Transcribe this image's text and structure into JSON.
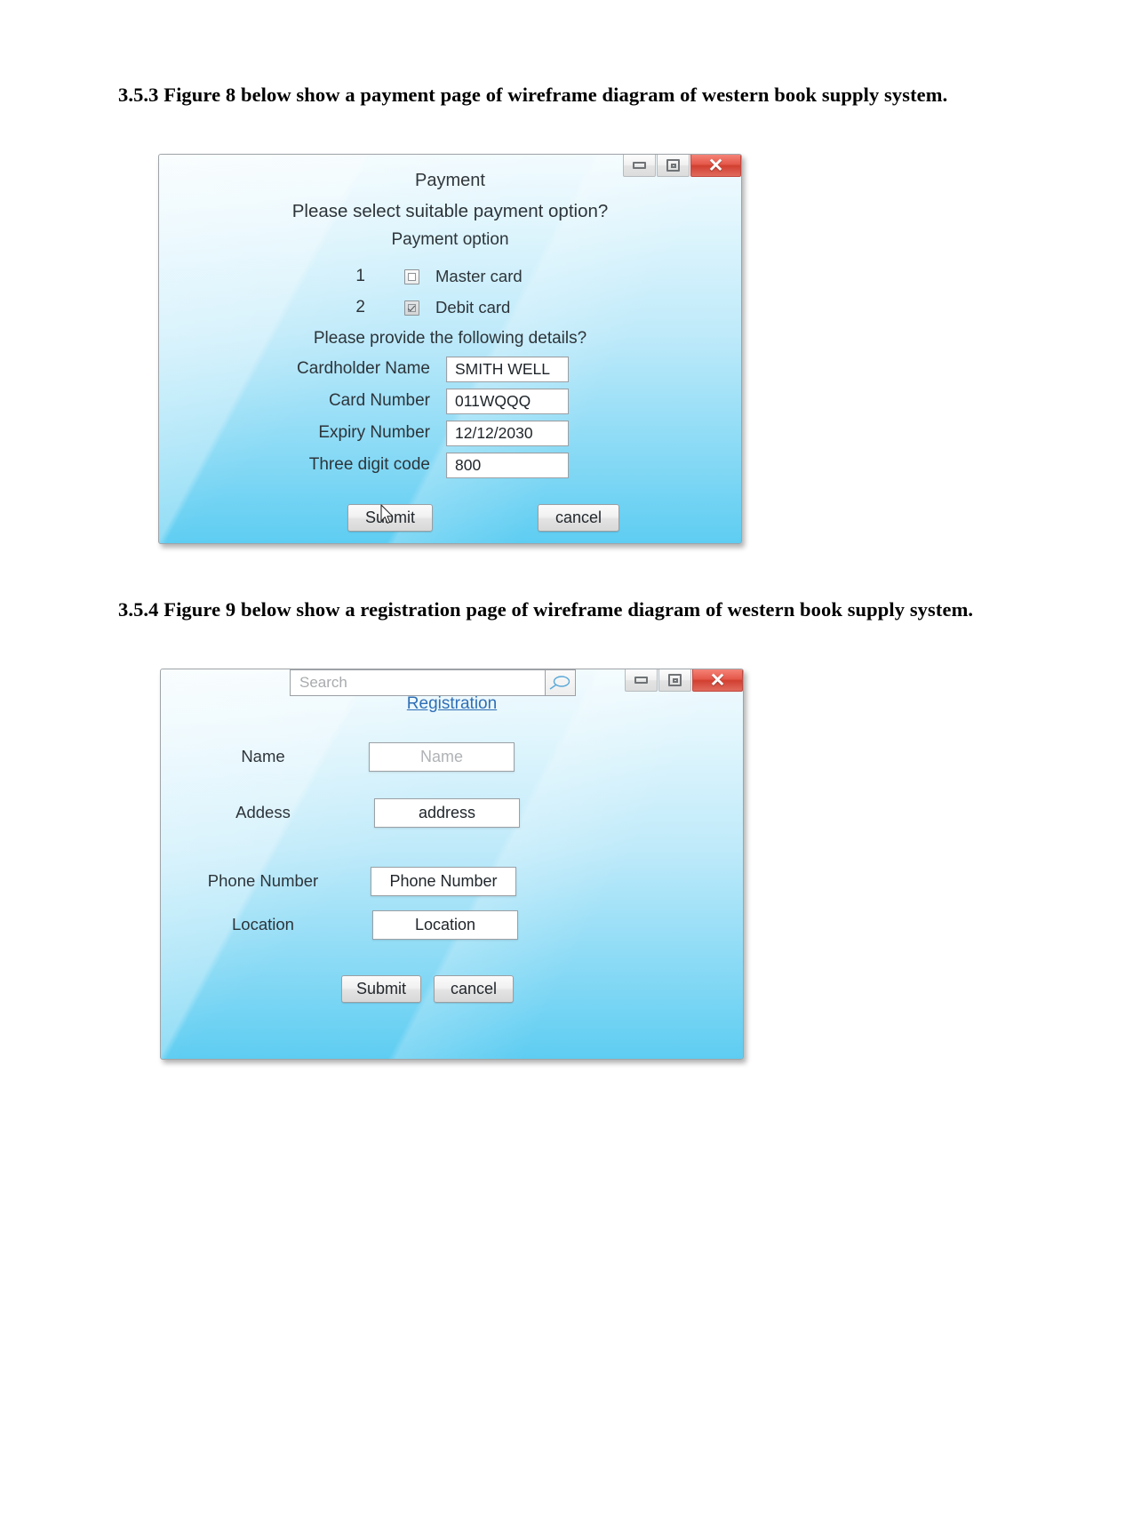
{
  "document": {
    "headings": [
      "3.5.3 Figure 8 below show a payment  page of wireframe diagram of western book supply system.",
      "3.5.4 Figure 9 below show a registration  page of wireframe diagram of western book supply system."
    ]
  },
  "payment_window": {
    "title": "Payment",
    "prompt": "Please select suitable payment option?",
    "subtitle": "Payment option",
    "options": [
      {
        "number": "1",
        "label": "Master card",
        "checked": false
      },
      {
        "number": "2",
        "label": "Debit card",
        "checked": true
      }
    ],
    "details_prompt": "Please provide the following details?",
    "fields": [
      {
        "label": "Cardholder Name",
        "value": "SMITH WELL"
      },
      {
        "label": "Card Number",
        "value": "011WQQQ"
      },
      {
        "label": "Expiry Number",
        "value": "12/12/2030"
      },
      {
        "label": "Three digit code",
        "value": "800"
      }
    ],
    "submit_label": "Submit",
    "cancel_label": "cancel",
    "controls": {
      "minimize": "minimize-icon",
      "maximize": "restore-icon",
      "close": "✕"
    }
  },
  "registration_window": {
    "search_placeholder": "Search",
    "search_icon": "magnifier-icon",
    "link_label": "Registration",
    "rows": [
      {
        "label": "Name",
        "value": "Name",
        "is_placeholder": true
      },
      {
        "label": "Addess",
        "value": "address",
        "is_placeholder": false
      },
      {
        "label": "Phone Number",
        "value": "Phone Number",
        "is_placeholder": false
      },
      {
        "label": "Location",
        "value": "Location",
        "is_placeholder": false
      }
    ],
    "submit_label": "Submit",
    "cancel_label": "cancel",
    "controls": {
      "minimize": "minimize-icon",
      "maximize": "restore-icon",
      "close": "✕"
    }
  },
  "colors": {
    "window_top": "#f2fbfe",
    "window_bottom": "#5ecdf2",
    "close_button": "#d13f30",
    "link": "#2f6fb5",
    "text": "#2d343a"
  }
}
